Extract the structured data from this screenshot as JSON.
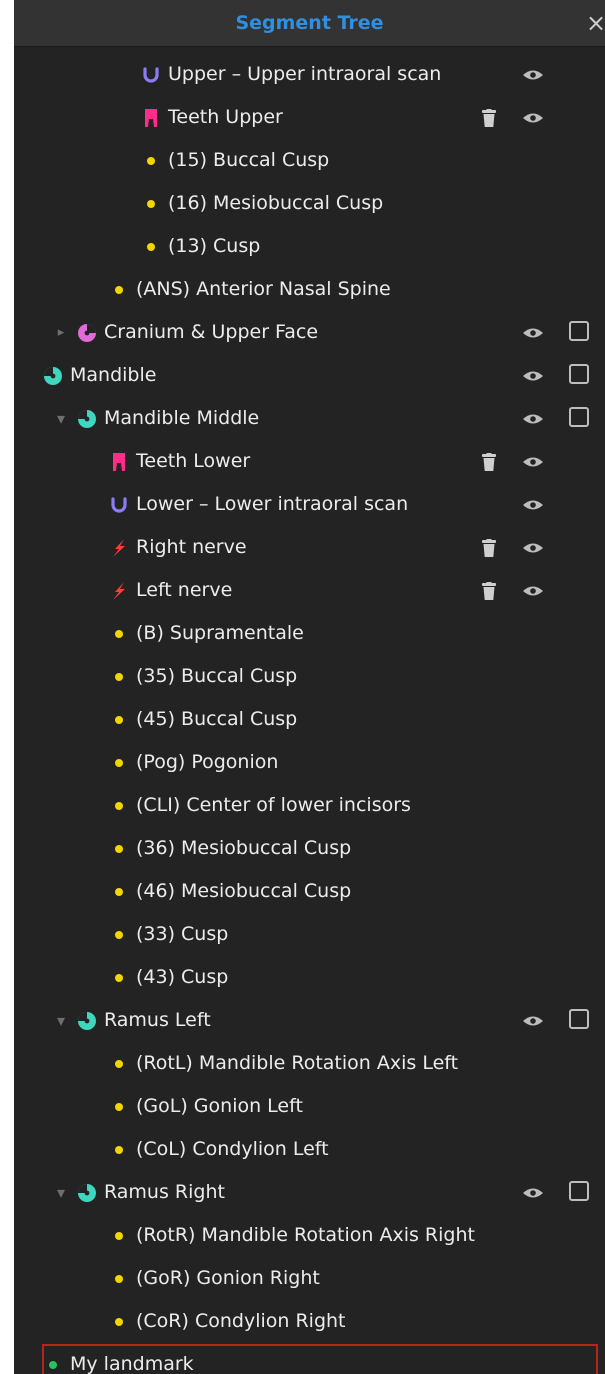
{
  "header": {
    "title": "Segment Tree",
    "close_glyph": "×"
  },
  "colors": {
    "title": "#2f8fe0",
    "point": "#f2d600",
    "point_green": "#22c55e",
    "scan": "#8b7cf6",
    "teeth": "#ff2d8a",
    "nerve": "#ff3b30",
    "cranium": "#e06bd8",
    "mandible": "#3fd6c0",
    "selection_border": "#b3261e"
  },
  "rows": [
    {
      "label": "Upper – Upper intraoral scan",
      "icon": "scan-arch-icon",
      "indent": 3,
      "eye": true
    },
    {
      "label": "Teeth Upper",
      "icon": "tooth-icon",
      "indent": 3,
      "trash": true,
      "eye": true
    },
    {
      "label": "(15) Buccal Cusp",
      "icon": "point-icon",
      "indent": 3
    },
    {
      "label": "(16) Mesiobuccal Cusp",
      "icon": "point-icon",
      "indent": 3
    },
    {
      "label": "(13) Cusp",
      "icon": "point-icon",
      "indent": 3
    },
    {
      "label": "(ANS) Anterior Nasal Spine",
      "icon": "point-icon",
      "indent": 2
    },
    {
      "label": "Cranium & Upper Face",
      "icon": "cranium-icon",
      "indent": 1,
      "twisty": "collapsed",
      "eye": true,
      "checkbox": true
    },
    {
      "label": "Mandible",
      "icon": "mandible-icon",
      "indent": 0,
      "eye": true,
      "checkbox": true
    },
    {
      "label": "Mandible Middle",
      "icon": "mandible-icon",
      "indent": 1,
      "twisty": "expanded",
      "eye": true,
      "checkbox": true
    },
    {
      "label": "Teeth Lower",
      "icon": "tooth-icon",
      "indent": 2,
      "trash": true,
      "eye": true
    },
    {
      "label": "Lower – Lower intraoral scan",
      "icon": "scan-arch-icon",
      "indent": 2,
      "eye": true
    },
    {
      "label": "Right nerve",
      "icon": "nerve-icon",
      "indent": 2,
      "trash": true,
      "eye": true
    },
    {
      "label": "Left nerve",
      "icon": "nerve-icon",
      "indent": 2,
      "trash": true,
      "eye": true
    },
    {
      "label": "(B) Supramentale",
      "icon": "point-icon",
      "indent": 2
    },
    {
      "label": "(35) Buccal Cusp",
      "icon": "point-icon",
      "indent": 2
    },
    {
      "label": "(45) Buccal Cusp",
      "icon": "point-icon",
      "indent": 2
    },
    {
      "label": "(Pog) Pogonion",
      "icon": "point-icon",
      "indent": 2
    },
    {
      "label": "(CLI) Center of lower incisors",
      "icon": "point-icon",
      "indent": 2
    },
    {
      "label": "(36) Mesiobuccal Cusp",
      "icon": "point-icon",
      "indent": 2
    },
    {
      "label": "(46) Mesiobuccal Cusp",
      "icon": "point-icon",
      "indent": 2
    },
    {
      "label": "(33) Cusp",
      "icon": "point-icon",
      "indent": 2
    },
    {
      "label": "(43) Cusp",
      "icon": "point-icon",
      "indent": 2
    },
    {
      "label": "Ramus Left",
      "icon": "mandible-icon",
      "indent": 1,
      "twisty": "expanded",
      "eye": true,
      "checkbox": true
    },
    {
      "label": "(RotL) Mandible Rotation Axis Left",
      "icon": "point-icon",
      "indent": 2
    },
    {
      "label": "(GoL) Gonion Left",
      "icon": "point-icon",
      "indent": 2
    },
    {
      "label": "(CoL) Condylion Left",
      "icon": "point-icon",
      "indent": 2
    },
    {
      "label": "Ramus Right",
      "icon": "mandible-icon",
      "indent": 1,
      "twisty": "expanded",
      "eye": true,
      "checkbox": true
    },
    {
      "label": "(RotR) Mandible Rotation Axis Right",
      "icon": "point-icon",
      "indent": 2
    },
    {
      "label": "(GoR) Gonion Right",
      "icon": "point-icon",
      "indent": 2
    },
    {
      "label": "(CoR) Condylion Right",
      "icon": "point-icon",
      "indent": 2
    },
    {
      "label": "My landmark",
      "icon": "point-green-icon",
      "indent": 0,
      "selected": true
    }
  ]
}
